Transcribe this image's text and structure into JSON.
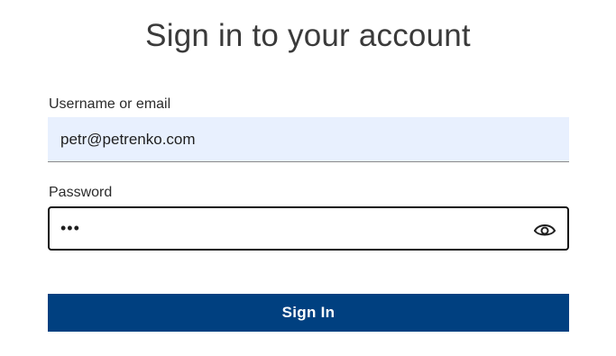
{
  "header": {
    "title": "Sign in to your account"
  },
  "form": {
    "username": {
      "label": "Username or email",
      "value": "petr@petrenko.com"
    },
    "password": {
      "label": "Password",
      "value": "•••",
      "toggle_icon": "eye-icon"
    },
    "submit_label": "Sign In"
  },
  "colors": {
    "primary_button": "#004080",
    "autofill_background": "#e8f0fe"
  }
}
